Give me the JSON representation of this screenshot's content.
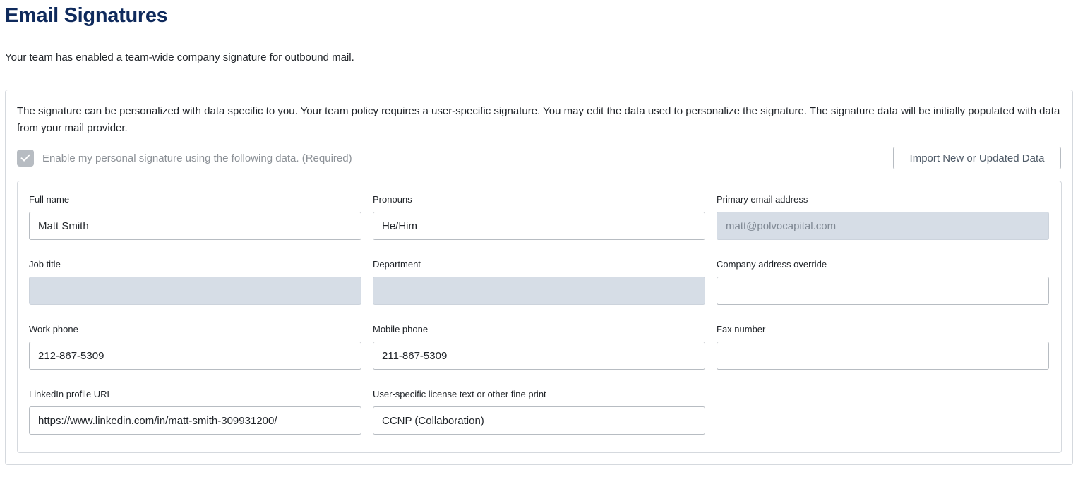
{
  "page": {
    "title": "Email Signatures",
    "intro": "Your team has enabled a team-wide company signature for outbound mail."
  },
  "card": {
    "description": "The signature can be personalized with data specific to you. Your team policy requires a user-specific signature. You may edit the data used to personalize the signature. The signature data will be initially populated with data from your mail provider.",
    "checkbox_label": "Enable my personal signature using the following data. (Required)",
    "checkbox_checked": true,
    "import_button_label": "Import New or Updated Data"
  },
  "fields": {
    "full_name": {
      "label": "Full name",
      "value": "Matt Smith",
      "disabled": false
    },
    "pronouns": {
      "label": "Pronouns",
      "value": "He/Him",
      "disabled": false
    },
    "primary_email": {
      "label": "Primary email address",
      "value": "matt@polvocapital.com",
      "disabled": true
    },
    "job_title": {
      "label": "Job title",
      "value": "",
      "disabled": true
    },
    "department": {
      "label": "Department",
      "value": "",
      "disabled": true
    },
    "company_address": {
      "label": "Company address override",
      "value": "",
      "disabled": false
    },
    "work_phone": {
      "label": "Work phone",
      "value": "212-867-5309",
      "disabled": false
    },
    "mobile_phone": {
      "label": "Mobile phone",
      "value": "211-867-5309",
      "disabled": false
    },
    "fax": {
      "label": "Fax number",
      "value": "",
      "disabled": false
    },
    "linkedin": {
      "label": "LinkedIn profile URL",
      "value": "https://www.linkedin.com/in/matt-smith-309931200/",
      "disabled": false
    },
    "license": {
      "label": "User-specific license text or other fine print",
      "value": "CCNP (Collaboration)",
      "disabled": false
    }
  },
  "colors": {
    "title": "#0f2a5c",
    "disabled_input_bg": "#d6dde6",
    "checkbox_bg": "#b7bcc2"
  },
  "icons": {
    "checkbox": "checkmark-icon"
  }
}
